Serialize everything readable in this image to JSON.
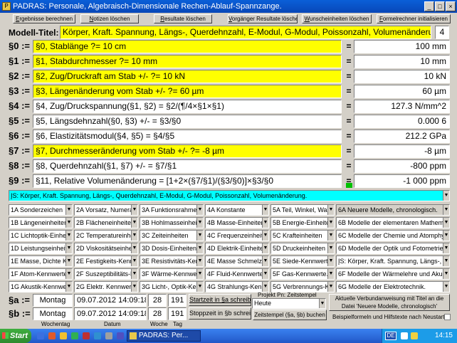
{
  "window": {
    "title": "PADRAS: Personale, Algebraisch-Dimensionale Rechen-Ablauf-Spannzange."
  },
  "toolbar": [
    {
      "pre": "",
      "key": "E",
      "post": "rgebnisse berechnen"
    },
    {
      "pre": "",
      "key": "N",
      "post": "otizen löschen"
    },
    {
      "pre": "",
      "key": "R",
      "post": "esultate löschen"
    },
    {
      "pre": "",
      "key": "V",
      "post": "orgänger Resultate löschen"
    },
    {
      "pre": "",
      "key": "W",
      "post": "unscheinheiten löschen"
    },
    {
      "pre": "",
      "key": "F",
      "post": "ormelrechner initialisieren"
    }
  ],
  "model": {
    "label": "Modell-Titel:",
    "title": "Körper, Kraft. Spannung, Längs-, Querdehnzahl, E-Modul, G-Modul, Poissonzahl, Volumenänderung.",
    "number": "4"
  },
  "rows": [
    {
      "sec": "§0 :=",
      "formula": "§0, Stablänge ?= 10 cm",
      "eq": "=",
      "result": "100 mm",
      "yellow": true
    },
    {
      "sec": "§1 :=",
      "formula": "§1, Stabdurchmesser ?= 10 mm",
      "eq": "=",
      "result": "10 mm",
      "yellow": true
    },
    {
      "sec": "§2 :=",
      "formula": "§2, Zug/Druckraft am Stab +/- ?= 10 kN",
      "eq": "=",
      "result": "10 kN",
      "yellow": true
    },
    {
      "sec": "§3 :=",
      "formula": "§3, Längenänderung vom Stab +/- ?= 60 µm",
      "eq": "=",
      "result": "60 µm",
      "yellow": true
    },
    {
      "sec": "§4 :=",
      "formula": "§4, Zug/Druckspannung(§1, §2) = §2/(¶/4×§1×§1)",
      "eq": "=",
      "result": "127.3 N/mm^2",
      "yellow": false
    },
    {
      "sec": "§5 :=",
      "formula": "§5, Längsdehnzahl(§0, §3) +/- = §3/§0",
      "eq": "=",
      "result": "0.000 6",
      "yellow": false
    },
    {
      "sec": "§6 :=",
      "formula": "§6, Elastizitätsmodul(§4, §5) = §4/§5",
      "eq": "=",
      "result": "212.2 GPa",
      "yellow": false
    },
    {
      "sec": "§7 :=",
      "formula": "§7, Durchmesseränderung vom Stab +/- ?= -8 µm",
      "eq": "=",
      "result": "-8 µm",
      "yellow": true
    },
    {
      "sec": "§8 :=",
      "formula": "§8, Querdehnzahl(§1, §7) +/- = §7/§1",
      "eq": "=",
      "result": "-800 ppm",
      "yellow": false
    },
    {
      "sec": "§9 :=",
      "formula": "§11, Relative Volumenänderung = [1+2×(§7/§1)/(§3/§0)]×§3/§0",
      "eq": "=",
      "result": "-1 000 ppm",
      "yellow": false
    }
  ],
  "selector": "ĮS: Körper, Kraft. Spannung, Längs-, Querdehnzahl, E-Modul, G-Modul, Poissonzahl, Volumenänderung.",
  "grid": [
    [
      "1A Sonderzeichen",
      "2A Vorsatz, Numeral",
      "3A Funktionsrahmen",
      "4A Konstante",
      "5A Teil, Winkel, Wahr",
      "6A Neuere Modelle, chronologisch."
    ],
    [
      "1B Längeneinheiten",
      "2B Flächeneinheiten",
      "3B Hohlmasseinheite",
      "4B Masse-Einheiten",
      "5B Energie-Einheiter",
      "6B Modelle der elementaren Mathematik."
    ],
    [
      "1C Lichtoptik-Einheit",
      "2C Temperatureinhe",
      "3C Zeiteinheiten",
      "4C Frequenzeinheite",
      "5C Krafteinheiten",
      "6C Modelle der Chemie und Atomphysik."
    ],
    [
      "1D Leistungseinheiter",
      "2D Viskositätseinheit",
      "3D Dosis-Einheiten",
      "4D Elektrik-Einheiten",
      "5D Druckeinheiten",
      "6D Modelle der Optik und Fotometrie."
    ],
    [
      "1E Masse, Dichte Ke",
      "2E Festigkeits-Kennw",
      "3E Resistivitäts-Kenn",
      "4E Masse Schmelz-I",
      "5E Siede-Kennwerte",
      "ĮS: Körper, Kraft. Spannung, Längs-, Querd"
    ],
    [
      "1F Atom-Kennwerte",
      "2F Suszeptibilitäts-K",
      "3F Wärme-Kennwer",
      "4F Fluid-Kennwerte.",
      "5F Gas-Kennwerte.",
      "6F Modelle der Wärmelehre und Akustik."
    ],
    [
      "1G Akustik-Kennwer",
      "2G Elektr. Kennwerte",
      "3G Licht-, Optik-Ken",
      "4G Strahlungs-Kenn",
      "5G Verbrennungs-Ke",
      "6G Modelle der Elektrotechnik."
    ]
  ],
  "time_a": {
    "label": "§a :=",
    "day": "Montag",
    "datetime": "09.07.2012 14:09:18",
    "week": "28",
    "doy": "191",
    "button": "Startzeit in §a schreiben"
  },
  "time_b": {
    "label": "§b :=",
    "day": "Montag",
    "datetime": "09.07.2012 14:09:18",
    "week": "28",
    "doy": "191",
    "button": "Stoppzeit in §b schreiben"
  },
  "col_labels": {
    "wochentag": "Wochentag",
    "datum": "Datum",
    "woche": "Woche",
    "tag": "Tag"
  },
  "project": {
    "label": "Projekt Pn: Zeitstempel",
    "value": "Heute",
    "button": "Zeitstempel (§a, §b) buchen"
  },
  "info_button": "Aktuelle Verbundanweisung mit Titel an die Datei 'Neuere Modelle, chronologisch' anfügen!",
  "checkbox_label": "Beispielformeln und Hilfstexte nach Neustart",
  "taskbar": {
    "start": "Start",
    "task": "PADRAS: Per...",
    "lang": "DE",
    "clock": "14:15"
  }
}
